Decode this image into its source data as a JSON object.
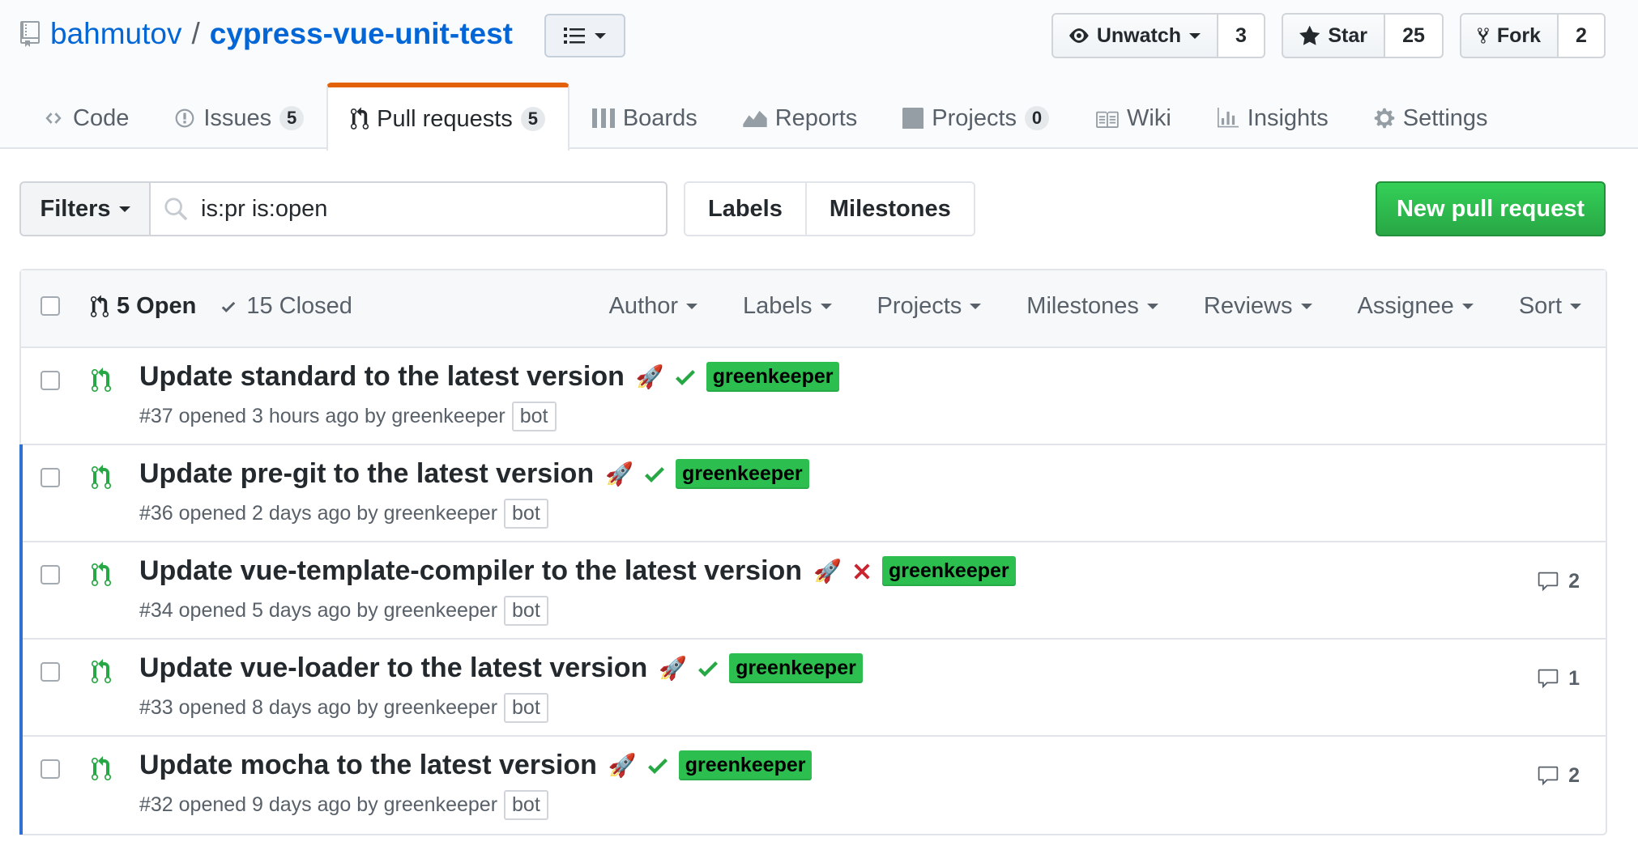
{
  "repo": {
    "owner": "bahmutov",
    "separator": "/",
    "name": "cypress-vue-unit-test"
  },
  "actions": {
    "watch": {
      "label": "Unwatch",
      "count": "3"
    },
    "star": {
      "label": "Star",
      "count": "25"
    },
    "fork": {
      "label": "Fork",
      "count": "2"
    }
  },
  "nav": {
    "code": "Code",
    "issues": "Issues",
    "issues_count": "5",
    "pulls": "Pull requests",
    "pulls_count": "5",
    "boards": "Boards",
    "reports": "Reports",
    "projects": "Projects",
    "projects_count": "0",
    "wiki": "Wiki",
    "insights": "Insights",
    "settings": "Settings"
  },
  "subnav": {
    "filters": "Filters",
    "search_value": "is:pr is:open",
    "labels": "Labels",
    "milestones": "Milestones",
    "new_pr": "New pull request"
  },
  "table": {
    "open": "5 Open",
    "closed": "15 Closed",
    "filters": [
      "Author",
      "Labels",
      "Projects",
      "Milestones",
      "Reviews",
      "Assignee",
      "Sort"
    ]
  },
  "prs": [
    {
      "title": "Update standard to the latest version",
      "status": "success",
      "label": "greenkeeper",
      "meta": "#37 opened 3 hours ago by greenkeeper",
      "badge": "bot",
      "comments": ""
    },
    {
      "title": "Update pre-git to the latest version",
      "status": "success",
      "label": "greenkeeper",
      "meta": "#36 opened 2 days ago by greenkeeper",
      "badge": "bot",
      "comments": ""
    },
    {
      "title": "Update vue-template-compiler to the latest version",
      "status": "failure",
      "label": "greenkeeper",
      "meta": "#34 opened 5 days ago by greenkeeper",
      "badge": "bot",
      "comments": "2"
    },
    {
      "title": "Update vue-loader to the latest version",
      "status": "success",
      "label": "greenkeeper",
      "meta": "#33 opened 8 days ago by greenkeeper",
      "badge": "bot",
      "comments": "1"
    },
    {
      "title": "Update mocha to the latest version",
      "status": "success",
      "label": "greenkeeper",
      "meta": "#32 opened 9 days ago by greenkeeper",
      "badge": "bot",
      "comments": "2"
    }
  ],
  "colors": {
    "link": "#0366d6",
    "label_bg": "#2cbe4e",
    "success": "#28a745",
    "failure": "#cb2431",
    "unread_bar": "#2f72d3",
    "selected_tab_accent": "#e36209"
  }
}
